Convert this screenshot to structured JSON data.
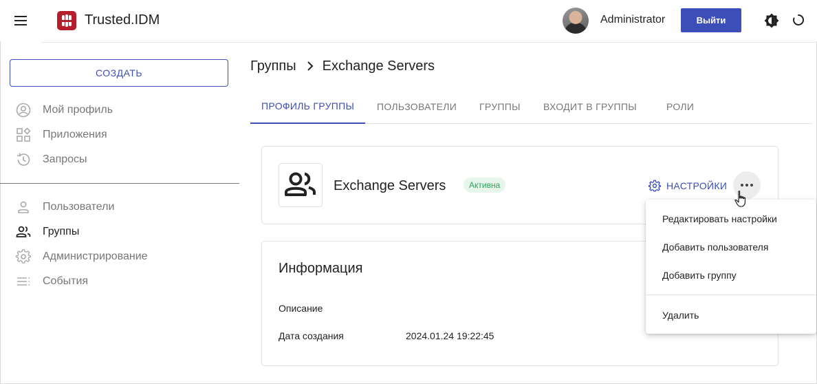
{
  "header": {
    "brand": "Trusted.IDM",
    "username": "Administrator",
    "logout_label": "Выйти",
    "icons": [
      "menu-icon",
      "logo-icon",
      "theme-toggle-icon",
      "loader-icon"
    ]
  },
  "sidebar": {
    "create_label": "СОЗДАТЬ",
    "items": [
      {
        "label": "Мой профиль",
        "icon": "profile-icon"
      },
      {
        "label": "Приложения",
        "icon": "apps-icon"
      },
      {
        "label": "Запросы",
        "icon": "history-icon"
      },
      {
        "label": "Пользователи",
        "icon": "user-icon"
      },
      {
        "label": "Группы",
        "icon": "group-icon"
      },
      {
        "label": "Администрирование",
        "icon": "gear-icon"
      },
      {
        "label": "События",
        "icon": "events-icon"
      }
    ],
    "active_item": "Группы"
  },
  "breadcrumb": {
    "parent": "Группы",
    "current": "Exchange Servers"
  },
  "tabs": [
    {
      "label": "ПРОФИЛЬ ГРУППЫ",
      "active": true
    },
    {
      "label": "ПОЛЬЗОВАТЕЛИ",
      "active": false
    },
    {
      "label": "ГРУППЫ",
      "active": false
    },
    {
      "label": "ВХОДИТ В ГРУППЫ",
      "active": false
    },
    {
      "label": "РОЛИ",
      "active": false
    }
  ],
  "group": {
    "name": "Exchange Servers",
    "status": "Активна",
    "settings_label": "НАСТРОЙКИ"
  },
  "info": {
    "title": "Информация",
    "description_label": "Описание",
    "description_value": "",
    "created_label": "Дата создания",
    "created_value": "2024.01.24 19:22:45"
  },
  "dropdown": {
    "items": [
      "Редактировать настройки",
      "Добавить пользователя",
      "Добавить группу",
      "Удалить"
    ]
  },
  "colors": {
    "accent": "#3d4eb8",
    "brand_red": "#b51f2d",
    "status_green": "#2ea35a",
    "status_green_bg": "#e6f6ec"
  }
}
